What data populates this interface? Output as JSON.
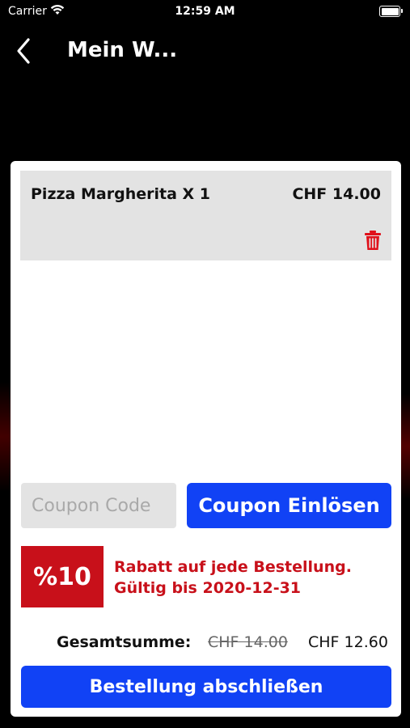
{
  "status_bar": {
    "carrier": "Carrier",
    "time": "12:59 AM"
  },
  "nav": {
    "title": "Mein W..."
  },
  "cart": {
    "items": [
      {
        "name": "Pizza Margherita X 1",
        "price": "CHF 14.00"
      }
    ]
  },
  "coupon": {
    "placeholder": "Coupon Code",
    "button_label": "Coupon Einlösen"
  },
  "discount": {
    "badge": "%10",
    "line1": "Rabatt auf jede Bestellung.",
    "line2": "Gültig bis 2020-12-31"
  },
  "total": {
    "label": "Gesamtsumme:",
    "original": "CHF 14.00",
    "discounted": "CHF 12.60"
  },
  "checkout": {
    "label": "Bestellung abschließen"
  },
  "colors": {
    "accent_blue": "#1142f5",
    "discount_red": "#c8101a",
    "item_bg": "#e3e3e3",
    "trash_red": "#e0101a"
  }
}
